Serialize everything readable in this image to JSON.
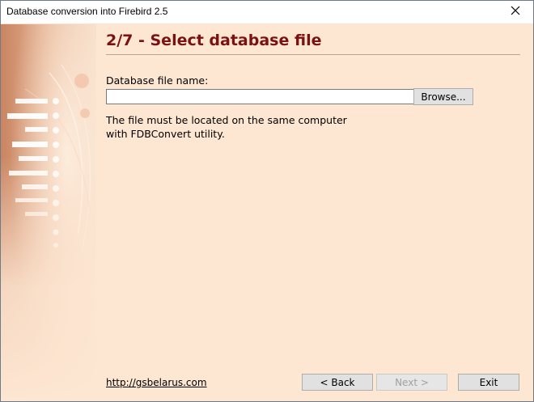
{
  "window": {
    "title": "Database conversion into Firebird 2.5",
    "close_icon": "close-icon"
  },
  "sidebar": {
    "decoration": "wizard-banner-image"
  },
  "page": {
    "heading": "2/7 - Select database file",
    "field_label": "Database file name:",
    "file_input_value": "",
    "browse_label": "Browse...",
    "info_line1": "The file must be located on the same computer",
    "info_line2": "with FDBConvert utility."
  },
  "footer": {
    "link_text": "http://gsbelarus.com",
    "back_label": "< Back",
    "next_label": "Next >",
    "exit_label": "Exit",
    "next_enabled": false
  },
  "colors": {
    "background": "#fde6d2",
    "heading": "#7a1212"
  }
}
